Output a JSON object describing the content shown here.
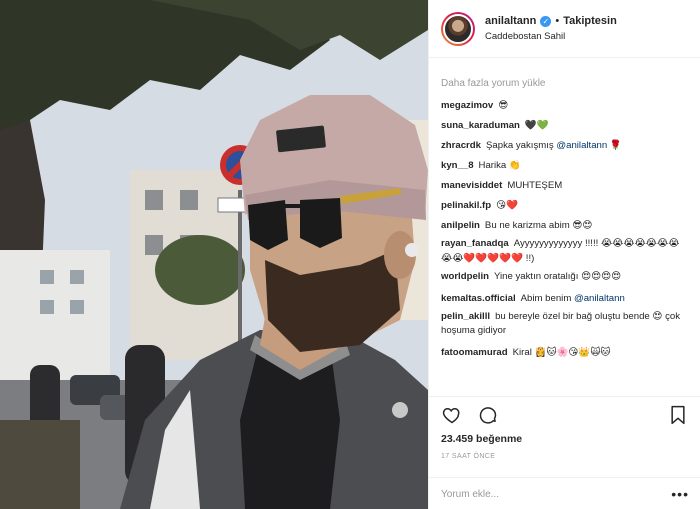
{
  "header": {
    "username": "anilaltann",
    "verified_glyph": "✓",
    "separator": "•",
    "follow_label": "Takiptesin",
    "location": "Caddebostan Sahil"
  },
  "comments": {
    "load_more": "Daha fazla yorum yükle",
    "items": [
      {
        "user": "megazimov",
        "text": "😎"
      },
      {
        "user": "suna_karaduman",
        "text": "🖤💚"
      },
      {
        "user": "zhracrdk",
        "text": "Şapka yakışmış",
        "mention": "@anilaltann",
        "after": " 🌹"
      },
      {
        "user": "kyn__8",
        "text": "Harika 👏"
      },
      {
        "user": "manevisiddet",
        "text": "MUHTEŞEM"
      },
      {
        "user": "pelinakil.fp",
        "text": "😘❤️"
      },
      {
        "user": "anilpelin",
        "text": "Bu ne karizma abim 😎😍"
      },
      {
        "user": "rayan_fanadqa",
        "text": "Ayyyyyyyyyyyyy !!!!! 😭😭😭😭😭😭😭😭😭❤️❤️❤️❤️❤️ !!)"
      },
      {
        "user": "worldpelin",
        "text": "Yine yaktın oratalığı 😍😍😍😍"
      },
      {
        "user": "kemaltas.official",
        "text": "Abim benim",
        "mention": "@anilaltann",
        "after": ""
      },
      {
        "user": "pelin_akilll",
        "text": "bu bereyle özel bir bağ oluştu bende 😍 çok hoşuma gidiyor"
      },
      {
        "user": "fatoomamurad",
        "text": "Kiral 👸🐱🌸😘👑🙀🐱"
      }
    ]
  },
  "actions": {
    "like_icon": "heart-outline-icon",
    "comment_icon": "comment-bubble-icon",
    "share_icon": "share-icon",
    "bookmark_icon": "bookmark-icon"
  },
  "likes_text": "23.459 beğenme",
  "timestamp": "17 SAAT ÖNCE",
  "add_comment": {
    "placeholder": "Yorum ekle...",
    "more_glyph": "•••"
  },
  "colors": {
    "verified": "#3897f0",
    "mention": "#003569",
    "muted": "#999999",
    "border": "#efefef"
  }
}
